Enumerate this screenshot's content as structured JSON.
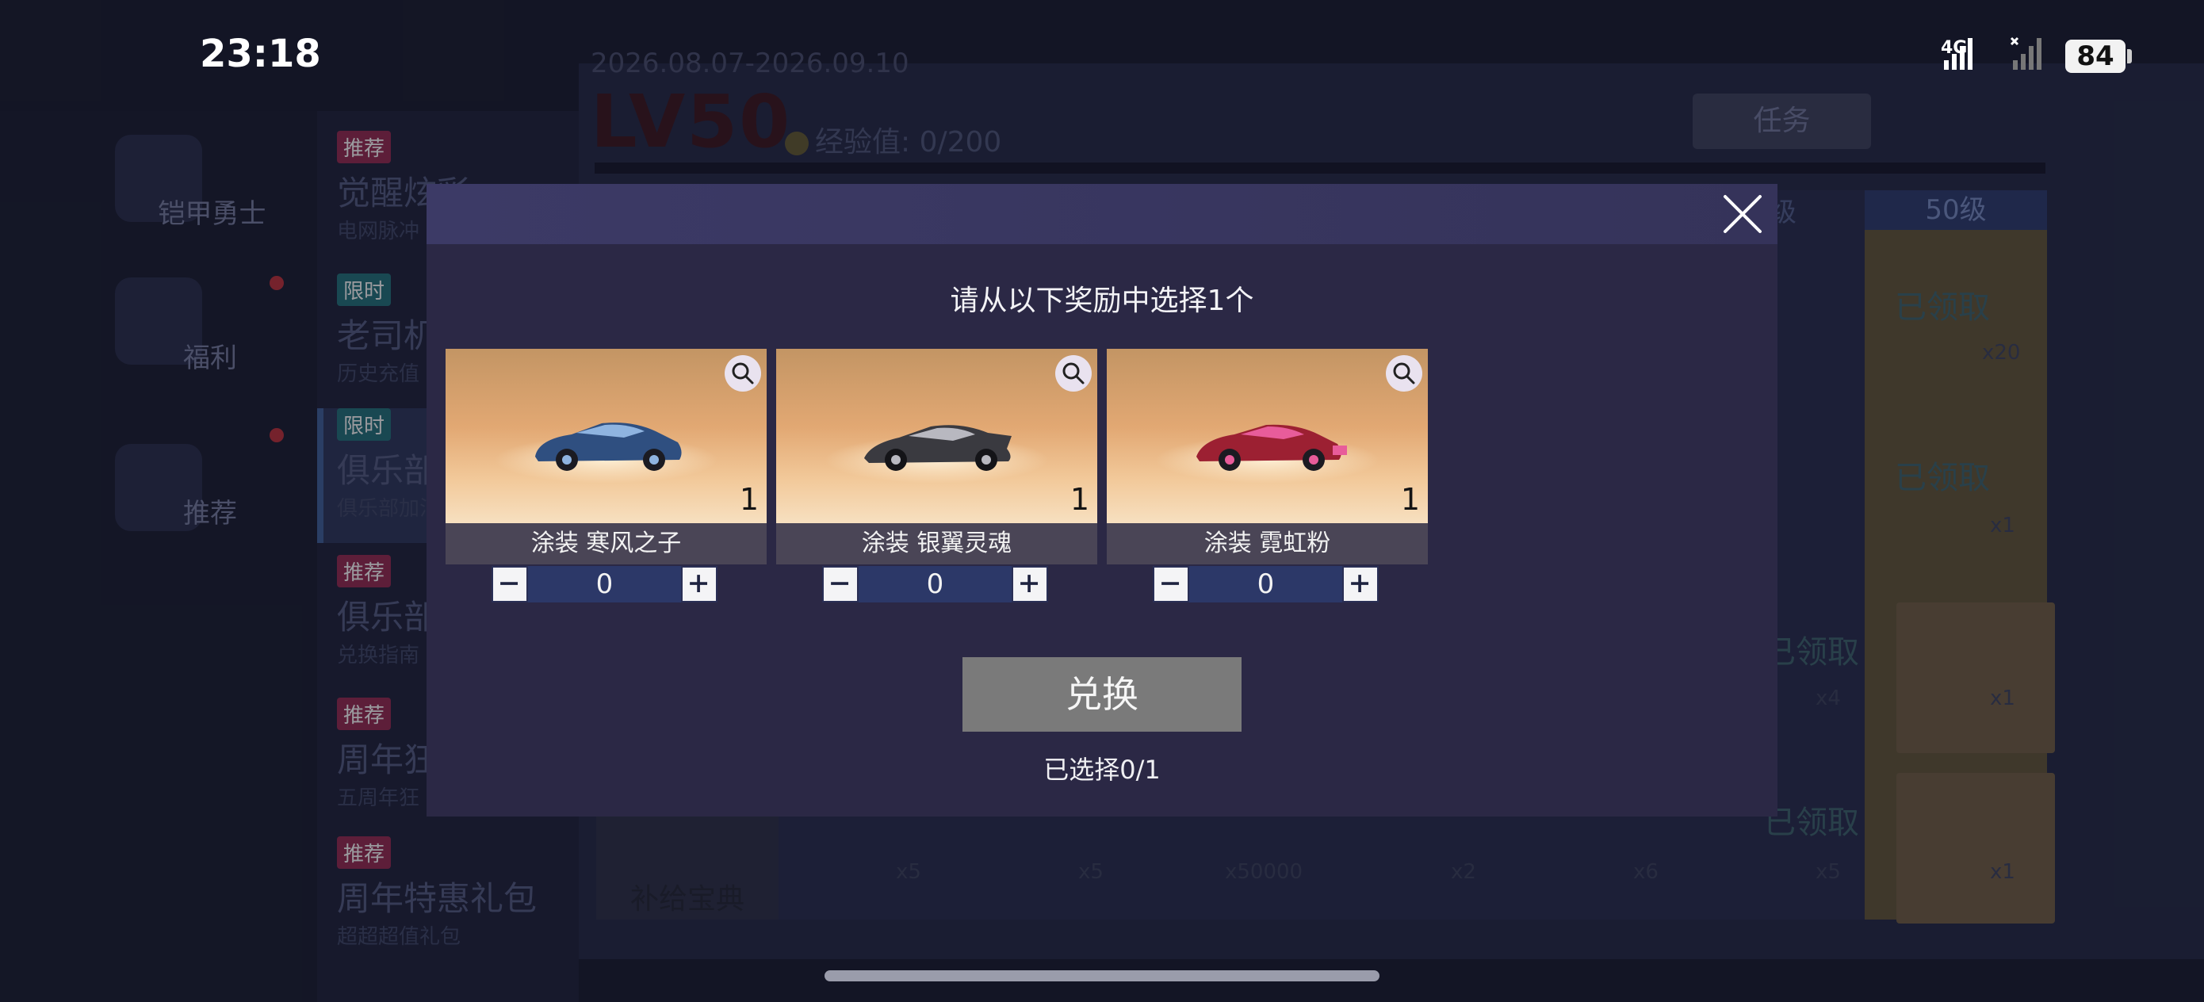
{
  "status_bar": {
    "time": "23:18",
    "network": "4G",
    "battery": "84"
  },
  "background": {
    "left_rail": [
      {
        "label": "铠甲勇士",
        "icon": "armor-hero-icon"
      },
      {
        "label": "福利",
        "icon": "gift-icon"
      },
      {
        "label": "推荐",
        "icon": "hot-icon"
      }
    ],
    "menu": [
      {
        "tag": "推荐",
        "title": "觉醒炫彩",
        "sub": "电网脉冲"
      },
      {
        "tag": "限时",
        "title": "老司机",
        "sub": "历史充值"
      },
      {
        "tag": "限时",
        "title": "俱乐部",
        "sub": "俱乐部加油"
      },
      {
        "tag": "推荐",
        "title": "俱乐部",
        "sub": "兑换指南"
      },
      {
        "tag": "推荐",
        "title": "周年狂",
        "sub": "五周年狂"
      },
      {
        "tag": "推荐",
        "title": "周年特惠礼包",
        "sub": "超超超值礼包"
      }
    ],
    "date_range": "2026.08.07-2026.09.10",
    "level": "LV50",
    "exp_label": "经验值: 0/200",
    "task_button": "任务",
    "level_header": "50级",
    "level_header_partial": "级",
    "claimed_label": "已领取",
    "counts": [
      "x20",
      "x1",
      "x4",
      "x1",
      "x5",
      "x5",
      "x50000",
      "x2",
      "x6",
      "x5",
      "x1"
    ],
    "book_label": "补给宝典"
  },
  "modal": {
    "title": "请从以下奖励中选择1个",
    "cards": [
      {
        "name": "涂装 寒风之子",
        "qty": "1",
        "count": "0",
        "car_color": "#2f4f80",
        "accent": "#8fb4e0"
      },
      {
        "name": "涂装 银翼灵魂",
        "qty": "1",
        "count": "0",
        "car_color": "#3a3a40",
        "accent": "#b8b8c0"
      },
      {
        "name": "涂装 霓虹粉",
        "qty": "1",
        "count": "0",
        "car_color": "#9c2032",
        "accent": "#e85c9a"
      }
    ],
    "exchange_button": "兑换",
    "selected_status": "已选择0/1"
  }
}
